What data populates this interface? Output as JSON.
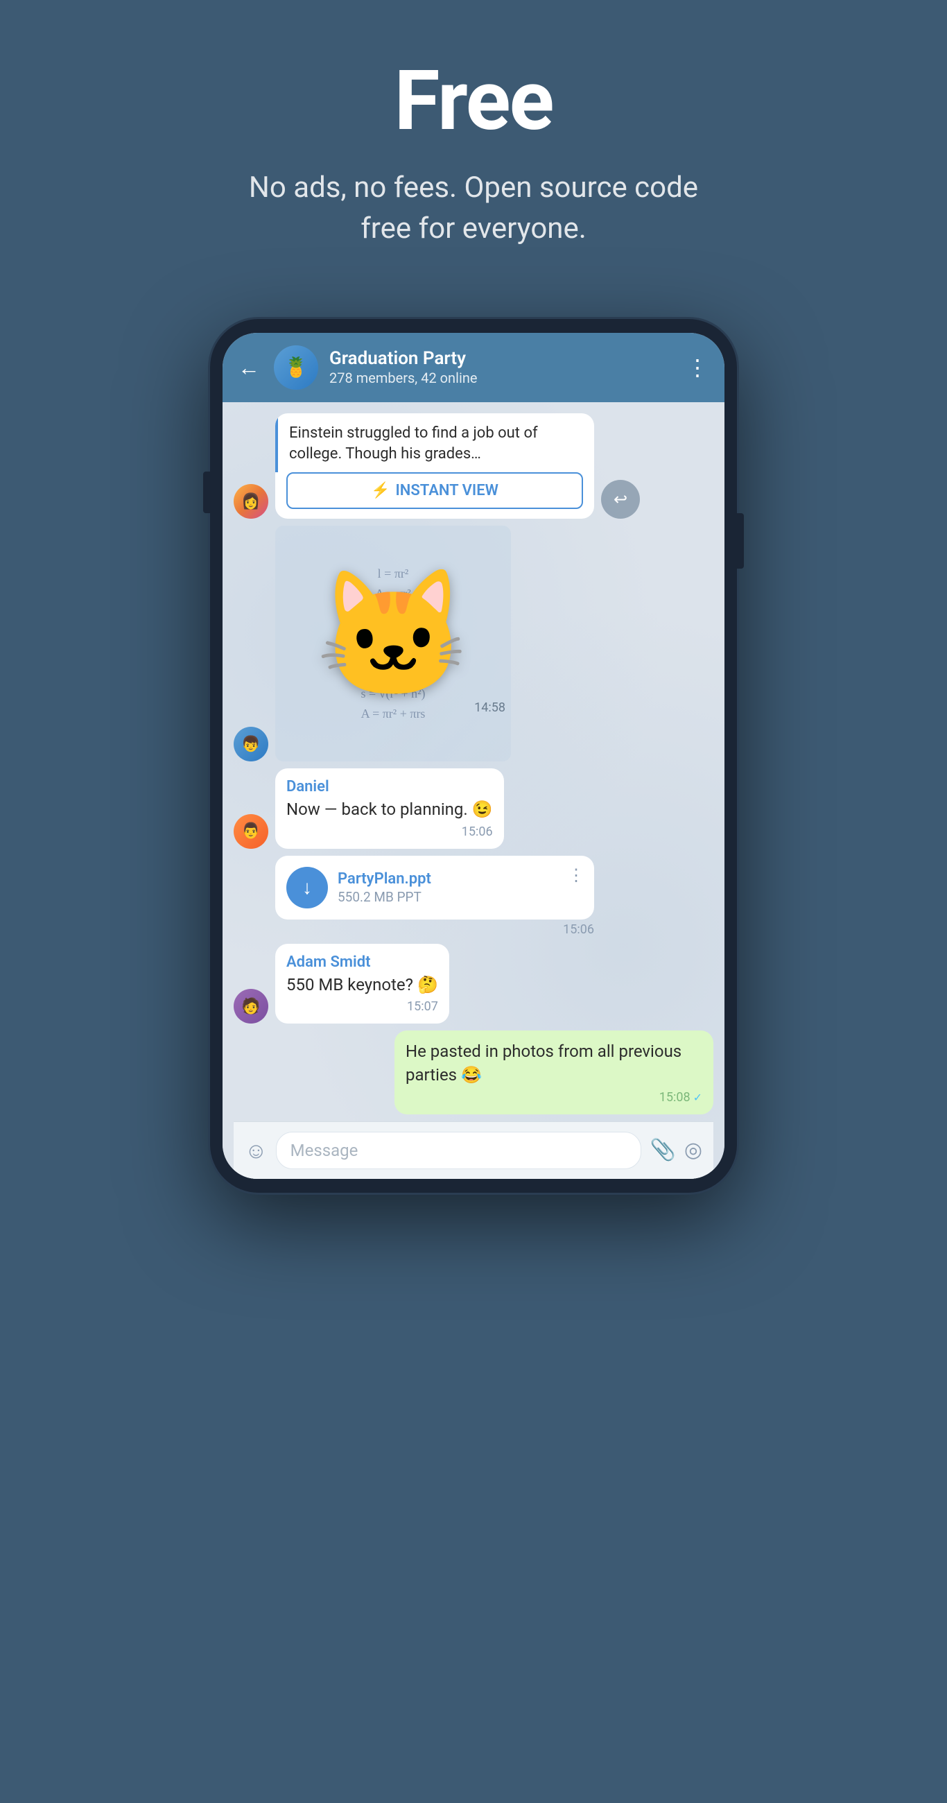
{
  "hero": {
    "title": "Free",
    "subtitle": "No ads, no fees. Open source code free for everyone."
  },
  "chat": {
    "back_icon": "←",
    "group_emoji": "🍍",
    "group_name": "Graduation Party",
    "group_members": "278 members, 42 online",
    "menu_icon": "⋮",
    "article_text": "Einstein struggled to find a job out of college. Though his grades…",
    "instant_view_label": "INSTANT VIEW",
    "instant_view_icon": "⚡",
    "sticker_time": "14:58",
    "messages": [
      {
        "id": "daniel-msg1",
        "sender": "Daniel",
        "text": "Now — back to planning. 😉",
        "time": "15:06",
        "side": "left",
        "avatar": "av-orange"
      }
    ],
    "file": {
      "name": "PartyPlan.ppt",
      "size": "550.2 MB PPT",
      "time": "15:06",
      "menu_icon": "⋮",
      "download_icon": "↓"
    },
    "adam_msg": {
      "sender": "Adam Smidt",
      "text": "550 MB keynote? 🤔",
      "time": "15:07",
      "avatar": "av-purple"
    },
    "own_msg": {
      "text": "He pasted in photos from all previous parties 😂",
      "time": "15:08",
      "checkmark": "✓",
      "side": "right"
    },
    "input": {
      "placeholder": "Message",
      "emoji_icon": "☺",
      "attach_icon": "📎",
      "camera_icon": "◎"
    },
    "share_icon": "↩"
  }
}
